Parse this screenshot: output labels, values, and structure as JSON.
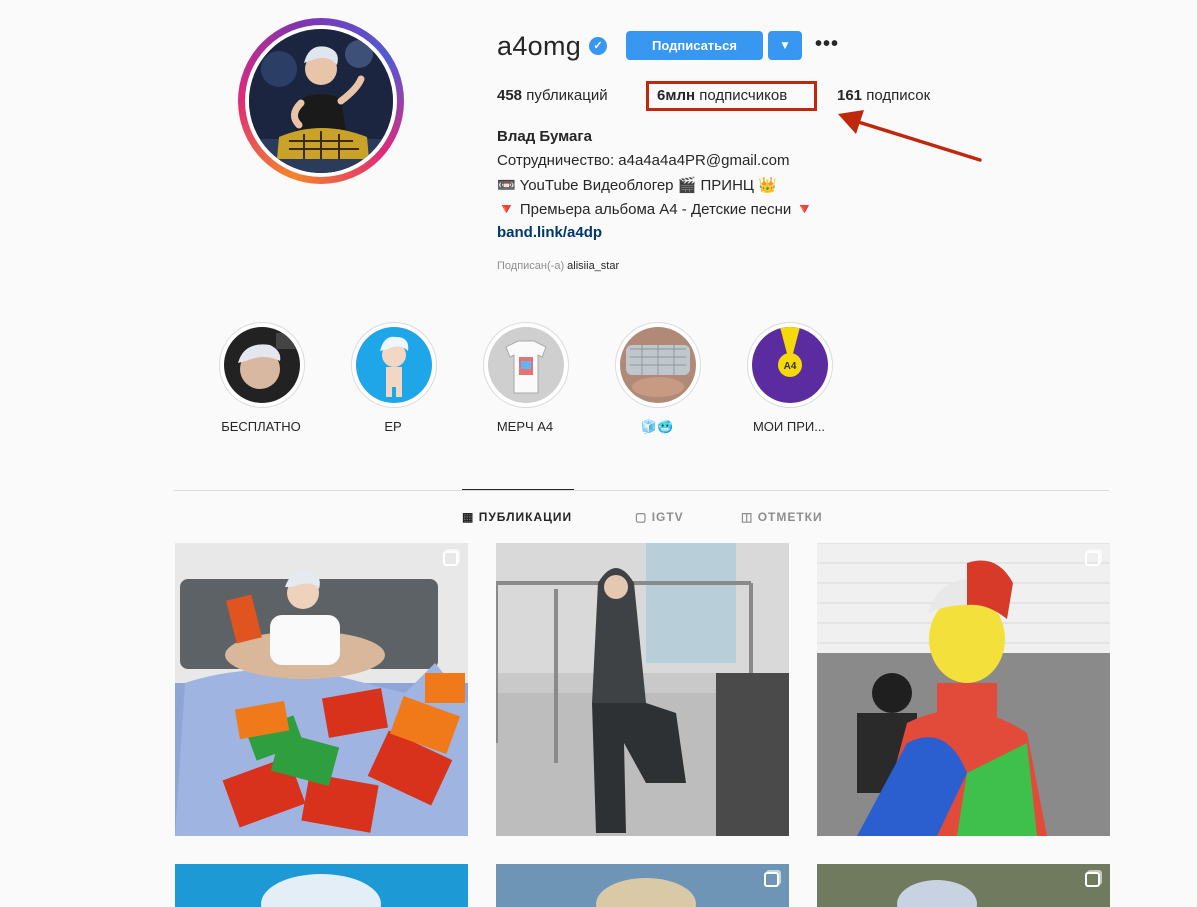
{
  "profile": {
    "username": "a4omg",
    "follow_label": "Подписаться",
    "dropdown_icon": "▼",
    "more_icon": "•••"
  },
  "stats": {
    "posts_count": "458",
    "posts_label": "публикаций",
    "followers_count": "6млн",
    "followers_label": "подписчиков",
    "following_count": "161",
    "following_label": "подписок"
  },
  "bio": {
    "name": "Влад Бумага",
    "line1": "Сотрудничество: a4a4a4a4PR@gmail.com",
    "line2": "📼 YouTube Видеоблогер 🎬 ПРИНЦ 👑",
    "line3": "🔻 Премьера альбома А4 - Детские песни 🔻",
    "link": "band.link/a4dp",
    "followed_by_label": "Подписан(-а)",
    "followed_by_user": "alisiia_star"
  },
  "highlights": [
    {
      "label": "БЕСПЛАТНО"
    },
    {
      "label": "EP"
    },
    {
      "label": "МЕРЧ А4"
    },
    {
      "label": "🧊🥶"
    },
    {
      "label": "МОИ ПРИ..."
    }
  ],
  "tabs": [
    {
      "label": "ПУБЛИКАЦИИ",
      "icon": "▦",
      "active": true
    },
    {
      "label": "IGTV",
      "icon": "▢",
      "active": false
    },
    {
      "label": "ОТМЕТКИ",
      "icon": "◫",
      "active": false
    }
  ],
  "annotation": {
    "highlight_color": "#c0280e",
    "arrow_color": "#c0280e"
  },
  "colors": {
    "accent": "#3897f0",
    "link": "#00376b",
    "muted": "#8e8e8e"
  }
}
